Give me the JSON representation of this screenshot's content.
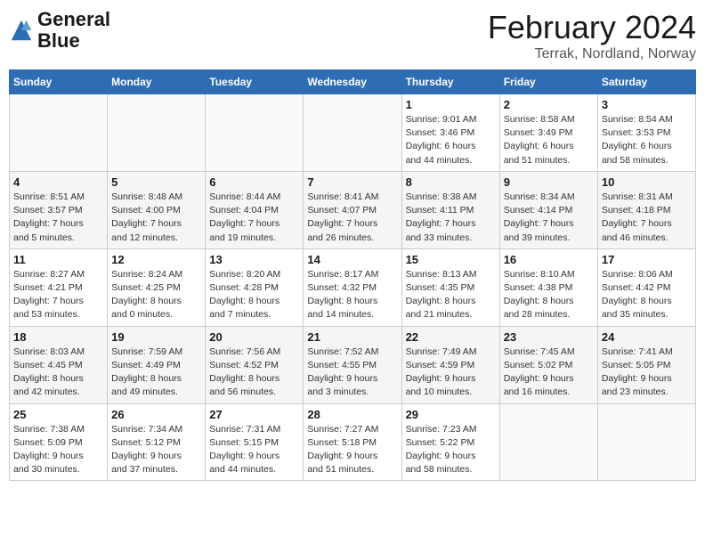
{
  "logo": {
    "line1": "General",
    "line2": "Blue"
  },
  "title": "February 2024",
  "location": "Terrak, Nordland, Norway",
  "days_of_week": [
    "Sunday",
    "Monday",
    "Tuesday",
    "Wednesday",
    "Thursday",
    "Friday",
    "Saturday"
  ],
  "weeks": [
    [
      {
        "day": "",
        "info": ""
      },
      {
        "day": "",
        "info": ""
      },
      {
        "day": "",
        "info": ""
      },
      {
        "day": "",
        "info": ""
      },
      {
        "day": "1",
        "info": "Sunrise: 9:01 AM\nSunset: 3:46 PM\nDaylight: 6 hours\nand 44 minutes."
      },
      {
        "day": "2",
        "info": "Sunrise: 8:58 AM\nSunset: 3:49 PM\nDaylight: 6 hours\nand 51 minutes."
      },
      {
        "day": "3",
        "info": "Sunrise: 8:54 AM\nSunset: 3:53 PM\nDaylight: 6 hours\nand 58 minutes."
      }
    ],
    [
      {
        "day": "4",
        "info": "Sunrise: 8:51 AM\nSunset: 3:57 PM\nDaylight: 7 hours\nand 5 minutes."
      },
      {
        "day": "5",
        "info": "Sunrise: 8:48 AM\nSunset: 4:00 PM\nDaylight: 7 hours\nand 12 minutes."
      },
      {
        "day": "6",
        "info": "Sunrise: 8:44 AM\nSunset: 4:04 PM\nDaylight: 7 hours\nand 19 minutes."
      },
      {
        "day": "7",
        "info": "Sunrise: 8:41 AM\nSunset: 4:07 PM\nDaylight: 7 hours\nand 26 minutes."
      },
      {
        "day": "8",
        "info": "Sunrise: 8:38 AM\nSunset: 4:11 PM\nDaylight: 7 hours\nand 33 minutes."
      },
      {
        "day": "9",
        "info": "Sunrise: 8:34 AM\nSunset: 4:14 PM\nDaylight: 7 hours\nand 39 minutes."
      },
      {
        "day": "10",
        "info": "Sunrise: 8:31 AM\nSunset: 4:18 PM\nDaylight: 7 hours\nand 46 minutes."
      }
    ],
    [
      {
        "day": "11",
        "info": "Sunrise: 8:27 AM\nSunset: 4:21 PM\nDaylight: 7 hours\nand 53 minutes."
      },
      {
        "day": "12",
        "info": "Sunrise: 8:24 AM\nSunset: 4:25 PM\nDaylight: 8 hours\nand 0 minutes."
      },
      {
        "day": "13",
        "info": "Sunrise: 8:20 AM\nSunset: 4:28 PM\nDaylight: 8 hours\nand 7 minutes."
      },
      {
        "day": "14",
        "info": "Sunrise: 8:17 AM\nSunset: 4:32 PM\nDaylight: 8 hours\nand 14 minutes."
      },
      {
        "day": "15",
        "info": "Sunrise: 8:13 AM\nSunset: 4:35 PM\nDaylight: 8 hours\nand 21 minutes."
      },
      {
        "day": "16",
        "info": "Sunrise: 8:10 AM\nSunset: 4:38 PM\nDaylight: 8 hours\nand 28 minutes."
      },
      {
        "day": "17",
        "info": "Sunrise: 8:06 AM\nSunset: 4:42 PM\nDaylight: 8 hours\nand 35 minutes."
      }
    ],
    [
      {
        "day": "18",
        "info": "Sunrise: 8:03 AM\nSunset: 4:45 PM\nDaylight: 8 hours\nand 42 minutes."
      },
      {
        "day": "19",
        "info": "Sunrise: 7:59 AM\nSunset: 4:49 PM\nDaylight: 8 hours\nand 49 minutes."
      },
      {
        "day": "20",
        "info": "Sunrise: 7:56 AM\nSunset: 4:52 PM\nDaylight: 8 hours\nand 56 minutes."
      },
      {
        "day": "21",
        "info": "Sunrise: 7:52 AM\nSunset: 4:55 PM\nDaylight: 9 hours\nand 3 minutes."
      },
      {
        "day": "22",
        "info": "Sunrise: 7:49 AM\nSunset: 4:59 PM\nDaylight: 9 hours\nand 10 minutes."
      },
      {
        "day": "23",
        "info": "Sunrise: 7:45 AM\nSunset: 5:02 PM\nDaylight: 9 hours\nand 16 minutes."
      },
      {
        "day": "24",
        "info": "Sunrise: 7:41 AM\nSunset: 5:05 PM\nDaylight: 9 hours\nand 23 minutes."
      }
    ],
    [
      {
        "day": "25",
        "info": "Sunrise: 7:38 AM\nSunset: 5:09 PM\nDaylight: 9 hours\nand 30 minutes."
      },
      {
        "day": "26",
        "info": "Sunrise: 7:34 AM\nSunset: 5:12 PM\nDaylight: 9 hours\nand 37 minutes."
      },
      {
        "day": "27",
        "info": "Sunrise: 7:31 AM\nSunset: 5:15 PM\nDaylight: 9 hours\nand 44 minutes."
      },
      {
        "day": "28",
        "info": "Sunrise: 7:27 AM\nSunset: 5:18 PM\nDaylight: 9 hours\nand 51 minutes."
      },
      {
        "day": "29",
        "info": "Sunrise: 7:23 AM\nSunset: 5:22 PM\nDaylight: 9 hours\nand 58 minutes."
      },
      {
        "day": "",
        "info": ""
      },
      {
        "day": "",
        "info": ""
      }
    ]
  ]
}
